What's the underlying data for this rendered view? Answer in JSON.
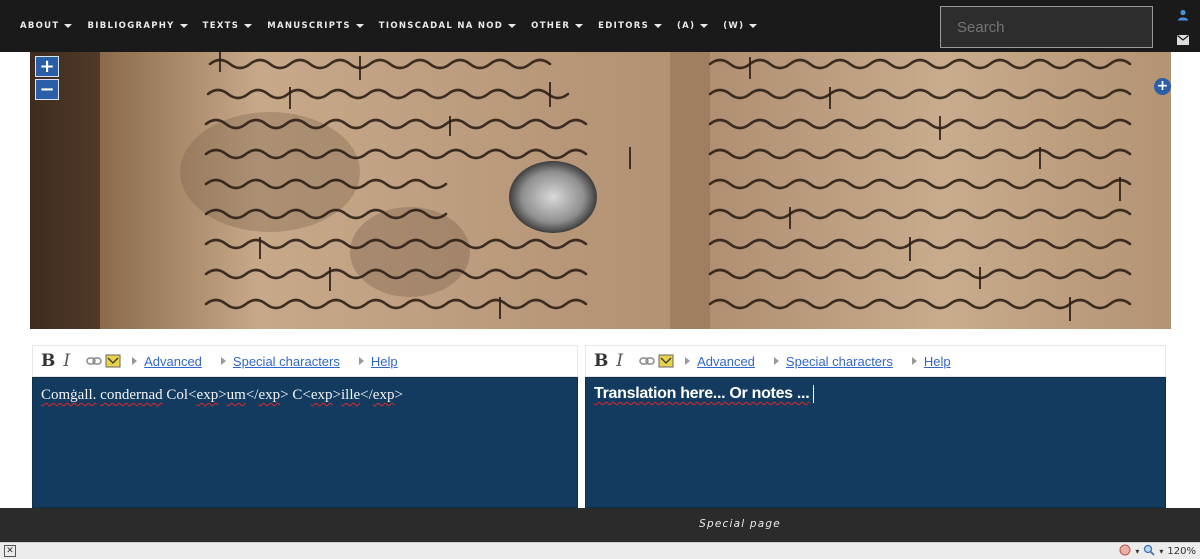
{
  "nav": {
    "items": [
      {
        "label": "ABOUT"
      },
      {
        "label": "BIBLIOGRAPHY"
      },
      {
        "label": "TEXTS"
      },
      {
        "label": "MANUSCRIPTS"
      },
      {
        "label": "TIONSCADAL NA NOD"
      },
      {
        "label": "OTHER"
      },
      {
        "label": "EDITORS"
      },
      {
        "label": "(A)"
      },
      {
        "label": "(W)"
      }
    ],
    "search_placeholder": "Search",
    "side_icons": [
      "user-icon",
      "mail-icon"
    ]
  },
  "viewer": {
    "zoom_in": "+",
    "zoom_out": "−",
    "expand": "+"
  },
  "editors": {
    "left": {
      "bold": "B",
      "italic": "I",
      "advanced": "Advanced",
      "special": "Special characters",
      "help": "Help",
      "text_parts": [
        "Comġall.",
        " ",
        "condernad",
        " Col<",
        "exp",
        ">",
        "um",
        "</",
        "exp",
        "> C<",
        "exp",
        ">",
        "ille",
        "</",
        "exp",
        ">"
      ]
    },
    "right": {
      "bold": "B",
      "italic": "I",
      "advanced": "Advanced",
      "special": "Special characters",
      "help": "Help",
      "text": "Translation here... Or notes ..."
    }
  },
  "footer": {
    "label": "Special page"
  },
  "statusbar": {
    "zoom": "120%"
  },
  "colors": {
    "nav_bg": "#1a1a1a",
    "editor_bg": "#133b5f",
    "link": "#3366cc",
    "button_blue": "#2a5fa8",
    "footer_bg": "#2b2b2b"
  }
}
